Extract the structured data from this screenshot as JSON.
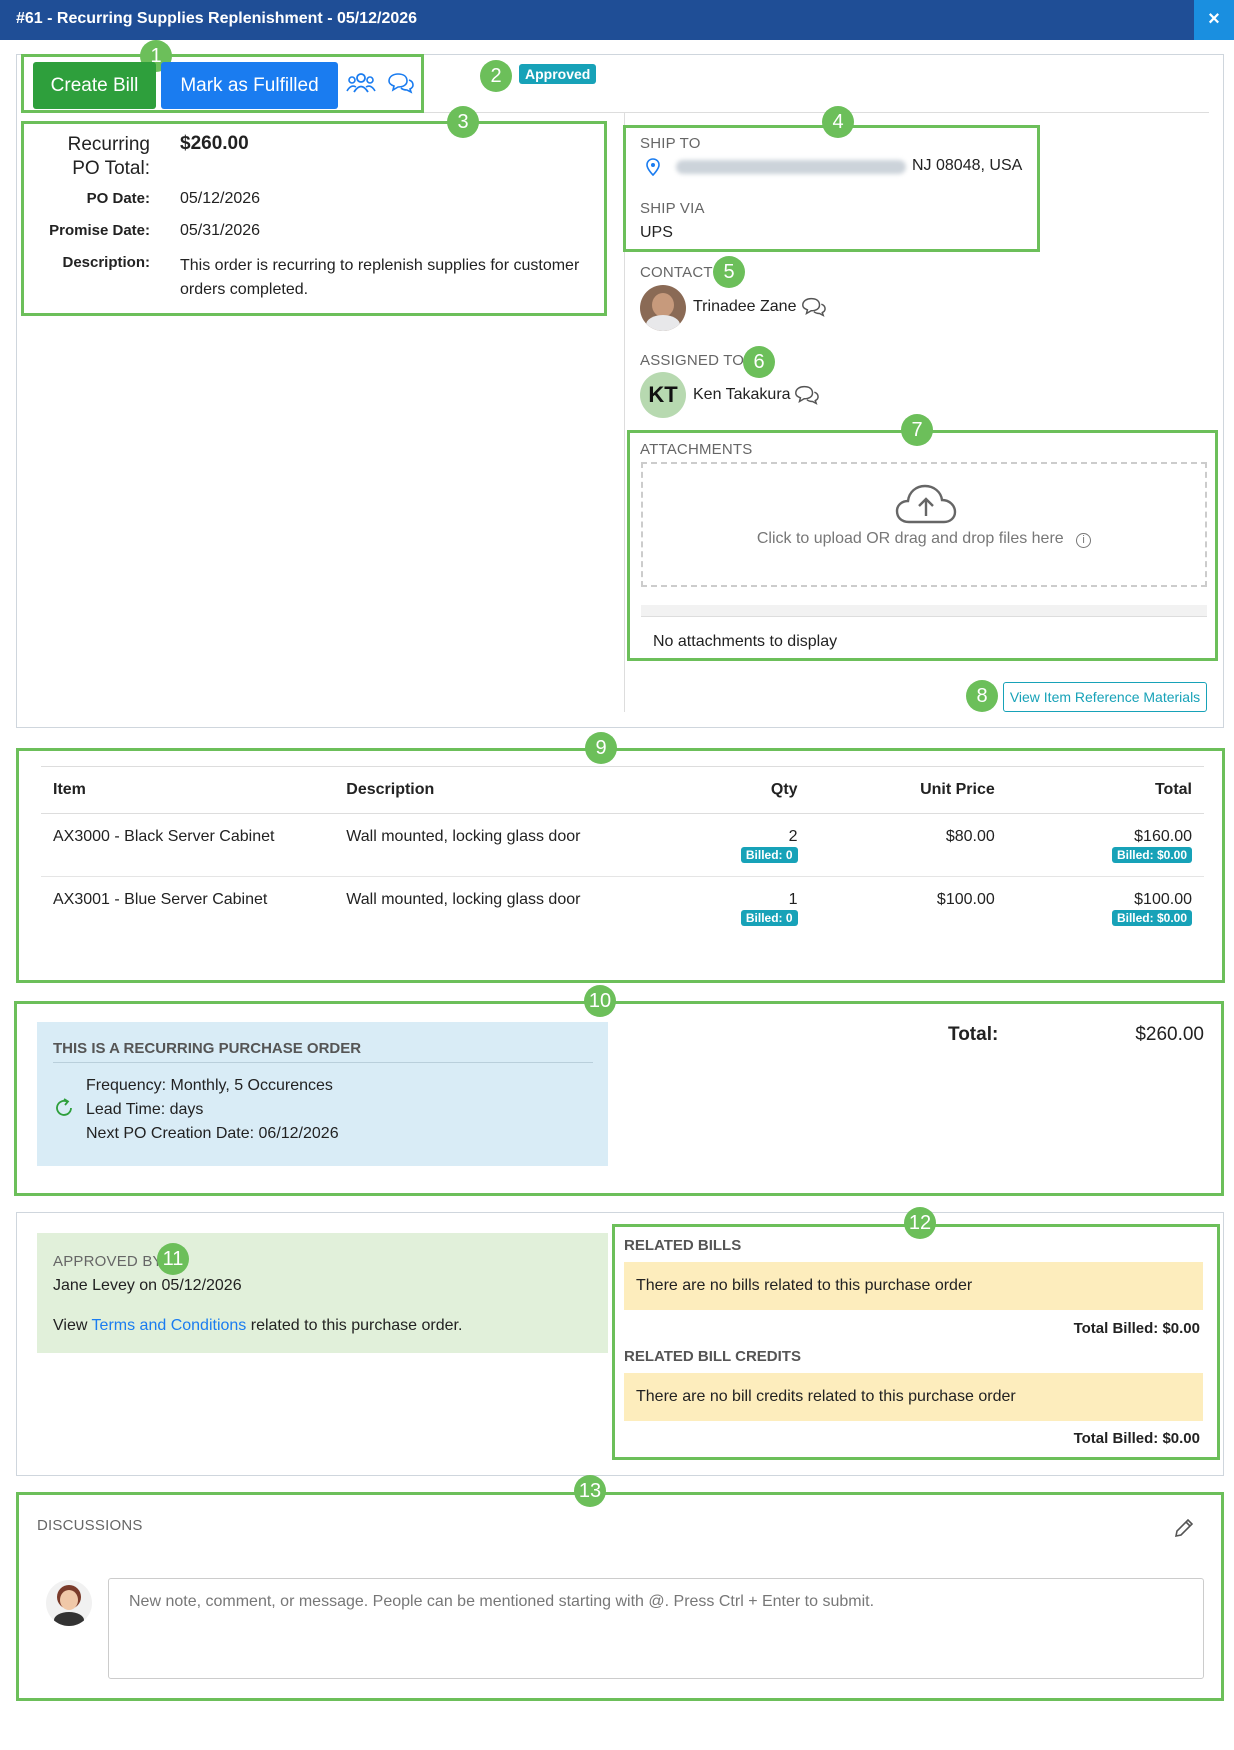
{
  "window": {
    "title": "#61 - Recurring Supplies Replenishment - 05/12/2026",
    "close": "×"
  },
  "toolbar": {
    "create_bill": "Create Bill",
    "mark_fulfilled": "Mark as Fulfilled",
    "status": "Approved"
  },
  "callouts": [
    "1",
    "2",
    "3",
    "4",
    "5",
    "6",
    "7",
    "8",
    "9",
    "10",
    "11",
    "12",
    "13"
  ],
  "summary": {
    "total_label_1": "Recurring",
    "total_label_2": "PO Total:",
    "total_value": "$260.00",
    "po_date_label": "PO Date:",
    "po_date": "05/12/2026",
    "promise_label": "Promise Date:",
    "promise_date": "05/31/2026",
    "desc_label": "Description:",
    "description": "This order is recurring to replenish supplies for customer orders completed."
  },
  "shipping": {
    "ship_to_label": "SHIP TO",
    "ship_to_visible": "NJ 08048, USA",
    "ship_via_label": "SHIP VIA",
    "ship_via": "UPS"
  },
  "contact": {
    "label": "CONTACT",
    "name": "Trinadee Zane"
  },
  "assigned": {
    "label": "ASSIGNED TO",
    "initials": "KT",
    "name": "Ken Takakura"
  },
  "attachments": {
    "label": "ATTACHMENTS",
    "drop_text": "Click to upload OR drag and drop files here",
    "empty": "No attachments to display"
  },
  "ref_button": "View Item Reference Materials",
  "items": {
    "headers": {
      "item": "Item",
      "description": "Description",
      "qty": "Qty",
      "unit_price": "Unit Price",
      "total": "Total"
    },
    "rows": [
      {
        "item": "AX3000 - Black Server Cabinet",
        "description": "Wall mounted, locking glass door",
        "qty": "2",
        "billed_qty": "Billed: 0",
        "unit_price": "$80.00",
        "total": "$160.00",
        "billed_total": "Billed: $0.00"
      },
      {
        "item": "AX3001 - Blue Server Cabinet",
        "description": "Wall mounted, locking glass door",
        "qty": "1",
        "billed_qty": "Billed: 0",
        "unit_price": "$100.00",
        "total": "$100.00",
        "billed_total": "Billed: $0.00"
      }
    ]
  },
  "recurring": {
    "title": "THIS IS A RECURRING PURCHASE ORDER",
    "frequency": "Frequency: Monthly, 5 Occurences",
    "lead_time": "Lead Time: days",
    "next_date": "Next PO Creation Date: 06/12/2026"
  },
  "totals": {
    "label": "Total:",
    "value": "$260.00"
  },
  "approval": {
    "label": "APPROVED BY",
    "by": "Jane Levey on 05/12/2026",
    "view": "View",
    "terms_link": "Terms and Conditions",
    "terms_rest": "related to this purchase order."
  },
  "related": {
    "bills_label": "RELATED BILLS",
    "bills_empty": "There are no bills related to this purchase order",
    "bills_total": "Total Billed: $0.00",
    "credits_label": "RELATED BILL CREDITS",
    "credits_empty": "There are no bill credits related to this purchase order",
    "credits_total": "Total Billed: $0.00"
  },
  "discussions": {
    "label": "DISCUSSIONS",
    "placeholder": "New note, comment, or message. People can be mentioned starting with @. Press Ctrl + Enter to submit."
  },
  "colors": {
    "header": "#1f4e96",
    "green_btn": "#2e9f3c",
    "blue_btn": "#1a7cf0",
    "callout": "#6cbf5a",
    "status": "#17a2b8"
  }
}
